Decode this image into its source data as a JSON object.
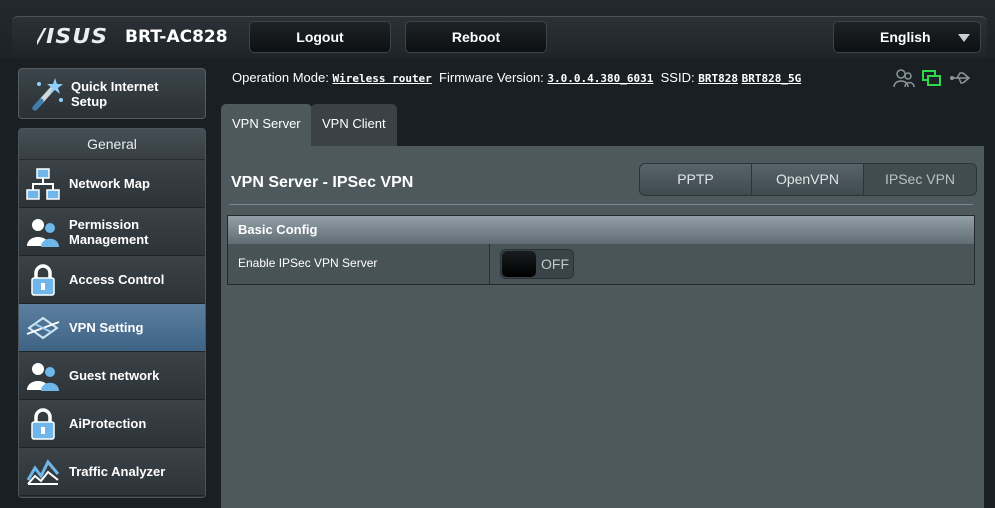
{
  "header": {
    "logo": "/ISUS",
    "model": "BRT-AC828",
    "logout_label": "Logout",
    "reboot_label": "Reboot",
    "language": "English"
  },
  "quick_setup": {
    "label_line1": "Quick Internet",
    "label_line2": "Setup"
  },
  "sidebar": {
    "heading": "General",
    "items": [
      {
        "label_line1": "Network Map",
        "label_line2": "",
        "icon": "network-map-icon"
      },
      {
        "label_line1": "Permission",
        "label_line2": "Management",
        "icon": "users-icon"
      },
      {
        "label_line1": "Access Control",
        "label_line2": "",
        "icon": "lock-icon"
      },
      {
        "label_line1": "VPN Setting",
        "label_line2": "",
        "icon": "vpn-icon",
        "active": true
      },
      {
        "label_line1": "Guest network",
        "label_line2": "",
        "icon": "guest-network-icon"
      },
      {
        "label_line1": "AiProtection",
        "label_line2": "",
        "icon": "lock-icon"
      },
      {
        "label_line1": "Traffic Analyzer",
        "label_line2": "",
        "icon": "traffic-analyzer-icon"
      }
    ]
  },
  "status": {
    "op_mode_label": "Operation Mode:",
    "op_mode_value": "Wireless router",
    "fw_label": "Firmware Version:",
    "fw_value": "3.0.0.4.380_6031",
    "ssid_label": "SSID:",
    "ssid_1": "BRT828",
    "ssid_2": "BRT828_5G"
  },
  "tabs": {
    "server": "VPN Server",
    "client": "VPN Client"
  },
  "main": {
    "title": "VPN Server - IPSec VPN",
    "protocols": [
      "PPTP",
      "OpenVPN",
      "IPSec VPN"
    ],
    "active_protocol": "IPSec VPN",
    "section_title": "Basic Config",
    "enable_label": "Enable IPSec VPN Server",
    "toggle_state": "OFF"
  }
}
